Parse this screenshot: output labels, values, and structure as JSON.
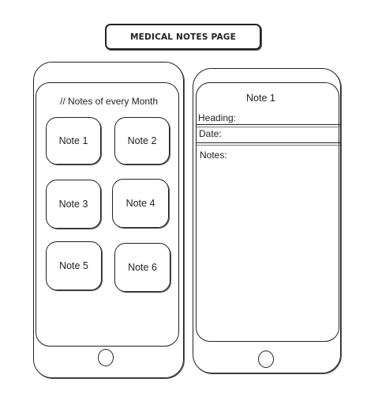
{
  "page_title": "MEDICAL NOTES PAGE",
  "left_phone": {
    "header": "// Notes of every Month",
    "notes": [
      "Note 1",
      "Note 2",
      "Note 3",
      "Note 4",
      "Note 5",
      "Note 6"
    ]
  },
  "right_phone": {
    "title": "Note 1",
    "heading_label": "Heading:",
    "date_label": "Date:",
    "notes_label": "Notes:"
  }
}
